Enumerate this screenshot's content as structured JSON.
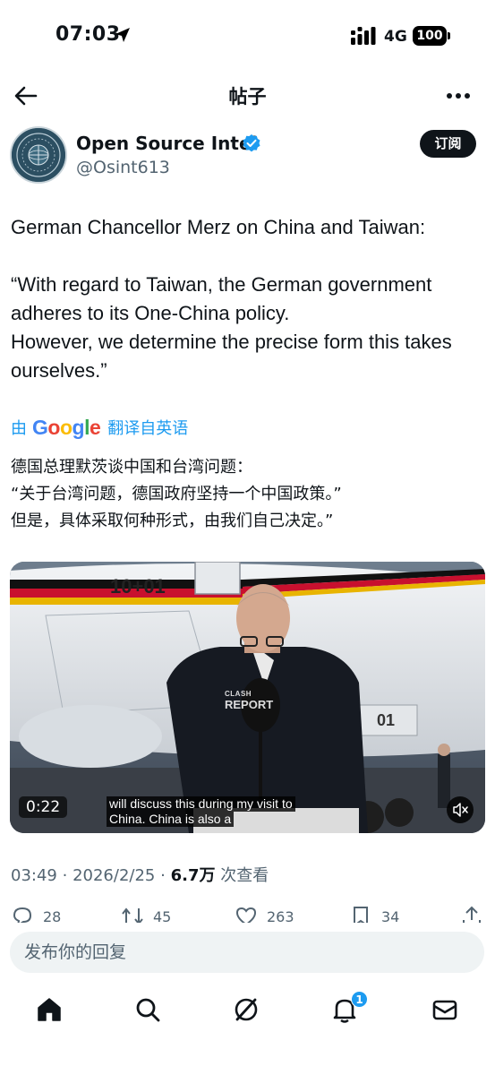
{
  "status_bar": {
    "time": "07:03",
    "network": "4G",
    "battery": "100"
  },
  "nav": {
    "title": "帖子"
  },
  "author": {
    "name": "Open Source Intel",
    "handle": "@Osint613",
    "subscribe_label": "订阅"
  },
  "tweet": {
    "text": "German Chancellor Merz on China and Taiwan:\n\n“With regard to Taiwan, the German government adheres to its One-China policy.\nHowever, we determine the precise form this takes ourselves.”",
    "translate_by": "由",
    "translate_label": "翻译自英语",
    "translated_text": "德国总理默茨谈中国和台湾问题：\n“关于台湾问题，德国政府坚持一个中国政策。”\n但是，具体采取何种形式，由我们自己决定。”"
  },
  "video": {
    "duration": "0:22",
    "caption_line1": "will discuss this during my visit to",
    "caption_line2": "China.  China is also a",
    "plane_number": "10+01",
    "gear_number": "01",
    "watermark_line1": "CLASH",
    "watermark_line2": "REPORT"
  },
  "meta": {
    "time": "03:49",
    "sep1": "·",
    "date": "2026/2/25",
    "sep2": "·",
    "views": "6.7万",
    "views_label": "次查看"
  },
  "actions": {
    "replies": "28",
    "reposts": "45",
    "likes": "263",
    "bookmarks": "34"
  },
  "reply": {
    "placeholder": "发布你的回复"
  },
  "tabs": {
    "notifications_badge": "1"
  },
  "colors": {
    "accent": "#1d9bf0",
    "text": "#0f1419",
    "secondary": "#536471"
  }
}
